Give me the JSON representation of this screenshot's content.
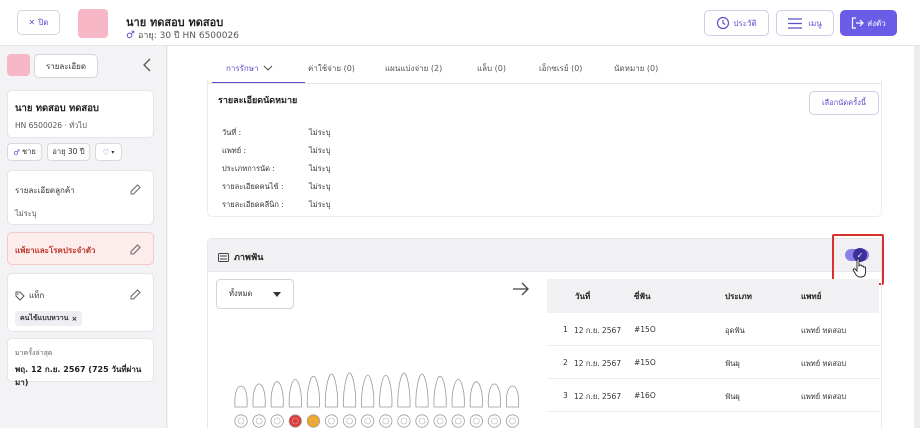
{
  "header": {
    "close_label": "ปิด",
    "patient_name": "นาย ทดสอบ ทดสอบ",
    "patient_sub": "อายุ: 30 ปี  HN 6500026",
    "history_label": "ประวัติ",
    "menu_label": "เมนู",
    "send_label": "ส่งตัว"
  },
  "sidebar": {
    "detail_button": "รายละเอียด",
    "name": "นาย ทดสอบ ทดสอบ",
    "hn_line": "HN 6500026 · ทั่วไป",
    "sex": "ชาย",
    "age": "อายุ 30 ปี",
    "customer_detail_title": "รายละเอียดลูกค้า",
    "customer_detail_value": "ไม่ระบุ",
    "allergy_title": "แพ้ยาและโรคประจำตัว",
    "tag_title": "แท็ก",
    "tag_value": "คนไข้แบบหวาน",
    "last_visit_label": "มาครั้งล่าสุด",
    "last_visit_value": "พฤ. 12 ก.ย. 2567 (725 วันที่ผ่านมา)"
  },
  "tabs": [
    {
      "label": "การรักษา"
    },
    {
      "label": "ค่าใช้จ่าย (0)"
    },
    {
      "label": "แผนแบ่งจ่าย (2)"
    },
    {
      "label": "แล็บ (0)"
    },
    {
      "label": "เอ็กซเรย์ (0)"
    },
    {
      "label": "นัดหมาย (0)"
    }
  ],
  "appointment": {
    "title": "รายละเอียดนัดหมาย",
    "choose_button": "เลือกนัดครั้งนี้",
    "rows": [
      {
        "label": "วันที่ :",
        "value": "ไม่ระบุ"
      },
      {
        "label": "แพทย์ :",
        "value": "ไม่ระบุ"
      },
      {
        "label": "ประเภทการนัด :",
        "value": "ไม่ระบุ"
      },
      {
        "label": "รายละเอียดคนไข้ :",
        "value": "ไม่ระบุ"
      },
      {
        "label": "รายละเอียดคลีนิก :",
        "value": "ไม่ระบุ"
      }
    ]
  },
  "xray": {
    "title": "ภาพฟัน",
    "toggle_on": true,
    "filter_value": "ทั้งหมด",
    "columns": [
      "วันที่",
      "ซี่ฟัน",
      "ประเภท",
      "แพทย์"
    ],
    "rows": [
      {
        "no": "1",
        "date": "12 ก.ย. 2567",
        "tooth": "#15O",
        "type": "อุดฟัน",
        "doctor": "แพทย์ ทดสอบ"
      },
      {
        "no": "2",
        "date": "12 ก.ย. 2567",
        "tooth": "#15O",
        "type": "ฟันผุ",
        "doctor": "แพทย์ ทดสอบ"
      },
      {
        "no": "3",
        "date": "12 ก.ย. 2567",
        "tooth": "#16O",
        "type": "ฟันผุ",
        "doctor": "แพทย์ ทดสอบ"
      }
    ]
  },
  "colors": {
    "accent": "#6b5ce7",
    "avatar": "#f8b7c6",
    "allergy": "#c0392b",
    "marker_red": "#e53935",
    "marker_orange": "#f5a623"
  }
}
